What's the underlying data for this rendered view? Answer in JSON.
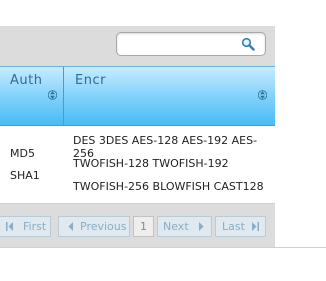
{
  "search": {
    "value": "",
    "placeholder": ""
  },
  "columns": [
    {
      "label": "Auth"
    },
    {
      "label": "Encr"
    }
  ],
  "row": {
    "auth": [
      "MD5",
      "SHA1"
    ],
    "encr": [
      "DES 3DES AES-128 AES-192 AES-256",
      "TWOFISH-128 TWOFISH-192",
      "TWOFISH-256 BLOWFISH CAST128"
    ]
  },
  "pagination": {
    "first": "First",
    "previous": "Previous",
    "page": "1",
    "next": "Next",
    "last": "Last"
  },
  "colors": {
    "header_gradient_top": "#c7ecff",
    "header_gradient_bottom": "#48bbf5",
    "header_text": "#2b6f9c",
    "pager_text": "#8aaec6",
    "toolbar_bg": "#dcdcdc"
  },
  "icons": {
    "search": "magnifier-icon",
    "sort": "sort-up-down-icon",
    "first": "first-page-icon",
    "previous": "previous-page-icon",
    "next": "next-page-icon",
    "last": "last-page-icon"
  }
}
